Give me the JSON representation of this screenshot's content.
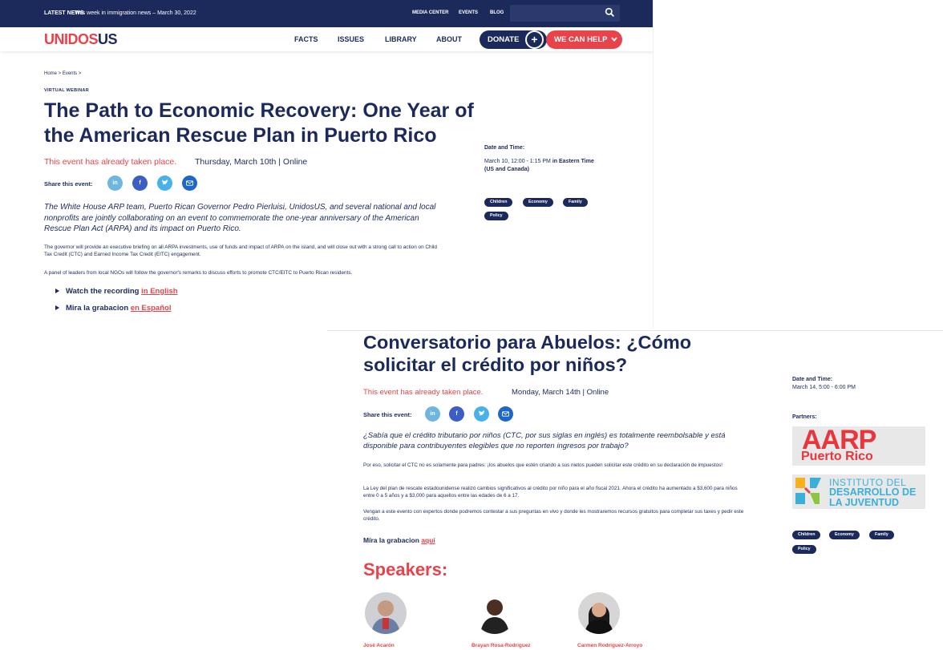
{
  "shot1": {
    "topbar": {
      "news_label": "LATEST NEWS",
      "news_text": "This week in immigration news – March 30, 2022",
      "media_center": "MEDIA CENTER",
      "events": "EVENTS",
      "blog": "BLOG"
    },
    "nav": {
      "logo_uni": "UNI",
      "logo_dos": "DOS",
      "logo_us": "US",
      "facts": "FACTS",
      "issues": "ISSUES",
      "library": "LIBRARY",
      "about": "ABOUT",
      "donate": "DONATE",
      "plus": "+",
      "we_can_help": "WE CAN HELP"
    },
    "breadcrumb": "Home  >  Events  >",
    "eyebrow": "VIRTUAL WEBINAR",
    "title": "The Path to Economic Recovery: One Year of the American Rescue Plan in Puerto Rico",
    "status": "This event has already taken place.",
    "date_line": "Thursday, March 10th   |   Online",
    "share_label": "Share this event:",
    "lede": "The White House ARP team, Puerto Rican Governor Pedro Pierluisi, UnidosUS, and several national and local nonprofits are jointly collaborating on an event to commemorate the one-year anniversary of the American Rescue Plan Act (ARPA) and its impact on Puerto Rico.",
    "para1": "The governor will provide an executive briefing on all ARPA investments, use of funds and impact of ARPA on the island, and will close out with a strong call to action on Child Tax Credit (CTC) and Earned Income Tax Credit (EITC) engagement.",
    "para2": "A panel of leaders from local NGOs will follow the governor's remarks to discuss efforts to promote CTC/EITC to Puerto Rican residents.",
    "watch_prefix": "Watch the recording",
    "watch_link": "in English",
    "mira_prefix": "Mira la grabacion",
    "mira_link": "en Español",
    "side": {
      "date_time_label": "Date and Time:",
      "date_time_value": "March 10, 12:00 - 1:15 PM",
      "date_time_tz": "in Eastern Time",
      "date_time_tz2": "(US and Canada)",
      "tags": [
        "Children",
        "Economy",
        "Family",
        "Policy"
      ]
    }
  },
  "shot2": {
    "title": "Conversatorio para Abuelos: ¿Cómo solicitar el crédito por niños?",
    "status": "This event has already taken place.",
    "date_line": "Monday, March 14th   |   Online",
    "share_label": "Share this event:",
    "lede": "¿Sabía que el crédito tributario por niños (CTC, por sus siglas en inglés) es totalmente reembolsable y está disponible para contribuyentes elegibles que no reporten ingresos por trabajo?",
    "para1": "Por eso, solicitar el CTC no es solamente para padres: ¡los abuelos que estén criando a sus nietos pueden solicitar este crédito en su declaración de impuestos!",
    "para2": "La Ley del plan de rescate estadounidense realizó cambios significativos al crédito por niño para el año fiscal 2021. Ahora el crédito ha aumentado a $3,600 para niños entre 0 a 5 años y a $3,000 para aquellos entre las edades de 6 a 17.",
    "para3": "Vengan a este evento con expertos donde podremos contestar a sus preguntas en vivo y donde les mostraremos recursos gratuitos para completar sus taxes y pedir este crédito.",
    "mira_prefix": "Míra la grabacion",
    "mira_link": "aquí",
    "speakers_heading": "Speakers:",
    "speakers": [
      "José Acarón",
      "Brayan Rosa-Rodriguez",
      "Carmen Rodriguez-Arroyo"
    ],
    "side": {
      "date_time_label": "Date and Time:",
      "date_time_value": "March 14, 5:00 - 6:00 PM",
      "partners_label": "Partners:",
      "aarp_main": "AARP",
      "aarp_sub": "Puerto Rico",
      "inst_line1": "INSTITUTO DEL",
      "inst_line2": "DESARROLLO DE",
      "inst_line3": "LA JUVENTUD",
      "tags": [
        "Children",
        "Economy",
        "Family",
        "Policy"
      ]
    }
  },
  "colors": {
    "navy": "#1b2a5a",
    "red": "#e8424a",
    "linkedin": "#6fb6de",
    "facebook": "#3b5ec4",
    "twitter": "#48b1ea",
    "email": "#1f66c9"
  }
}
